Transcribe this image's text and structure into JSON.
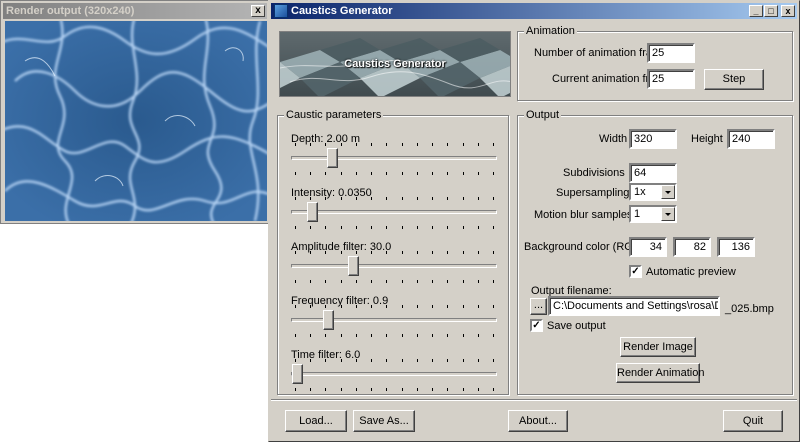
{
  "render_window": {
    "title": "Render output (320x240)",
    "close_glyph": "x"
  },
  "main_window": {
    "title": "Caustics Generator",
    "min_glyph": "_",
    "max_glyph": "□",
    "close_glyph": "x"
  },
  "banner": {
    "title": "Caustics Generator"
  },
  "animation": {
    "group_title": "Animation",
    "frames_label": "Number of animation frames",
    "frames_value": "25",
    "current_label": "Current animation frame",
    "current_value": "25",
    "step_label": "Step"
  },
  "caustic": {
    "group_title": "Caustic parameters",
    "sliders": [
      {
        "label": "Depth:  2.00 m",
        "position": 0.2
      },
      {
        "label": "Intensity: 0.0350",
        "position": 0.1
      },
      {
        "label": "Amplitude filter:  30.0",
        "position": 0.3
      },
      {
        "label": "Frequency filter:   0.9",
        "position": 0.18
      },
      {
        "label": "Time filter:    6.0",
        "position": 0.03
      }
    ]
  },
  "output": {
    "group_title": "Output",
    "width_label": "Width",
    "width_value": "320",
    "height_label": "Height",
    "height_value": "240",
    "subdivisions_label": "Subdivisions",
    "subdivisions_value": "64",
    "supersampling_label": "Supersampling",
    "supersampling_value": "1x",
    "motion_blur_label": "Motion blur samples",
    "motion_blur_value": "1",
    "bg_color_label": "Background color (RGB)",
    "bg_r": "34",
    "bg_g": "82",
    "bg_b": "136",
    "auto_preview_label": "Automatic preview",
    "auto_preview_checked": "✓",
    "filename_label": "Output filename:",
    "browse_label": "...",
    "filename_value": "C:\\Documents and Settings\\rosa\\Desktop",
    "filename_suffix": "_025.bmp",
    "save_output_label": "Save output",
    "save_output_checked": "✓",
    "render_image_label": "Render Image",
    "render_animation_label": "Render Animation"
  },
  "bottom": {
    "load_label": "Load...",
    "save_as_label": "Save As...",
    "about_label": "About...",
    "quit_label": "Quit"
  },
  "colors": {
    "water": "#2f5e92",
    "title_active": "#0a246a",
    "title_inactive": "#808080"
  }
}
